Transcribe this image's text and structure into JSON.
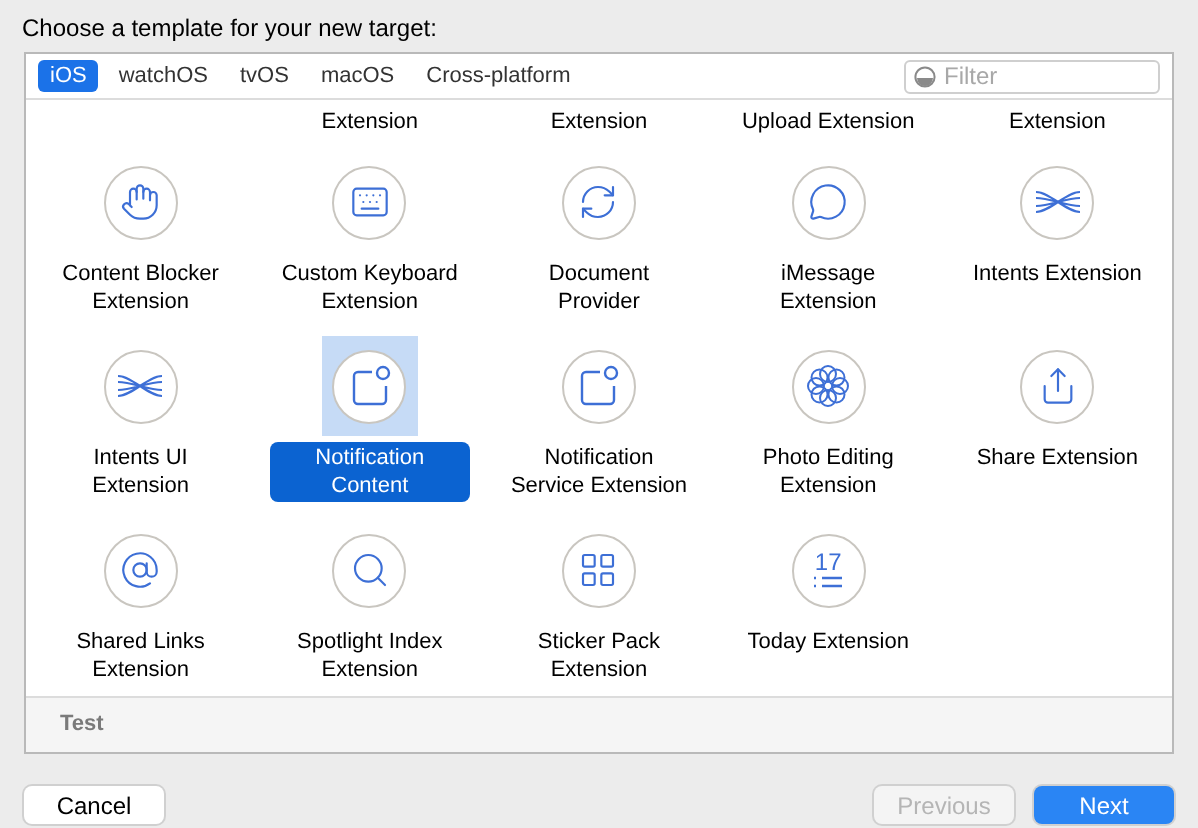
{
  "title": "Choose a template for your new target:",
  "tabs": [
    {
      "label": "iOS",
      "selected": true
    },
    {
      "label": "watchOS",
      "selected": false
    },
    {
      "label": "tvOS",
      "selected": false
    },
    {
      "label": "macOS",
      "selected": false
    },
    {
      "label": "Cross-platform",
      "selected": false
    }
  ],
  "filter": {
    "placeholder": "Filter"
  },
  "partial_row": [
    "Extension",
    "Extension",
    "Upload Extension",
    "Extension"
  ],
  "templates": [
    {
      "kind": "hand",
      "label": [
        "Content Blocker",
        "Extension"
      ],
      "selected": false
    },
    {
      "kind": "keyboard",
      "label": [
        "Custom Keyboard",
        "Extension"
      ],
      "selected": false
    },
    {
      "kind": "refresh",
      "label": [
        "Document",
        "Provider"
      ],
      "selected": false
    },
    {
      "kind": "bubble",
      "label": [
        "iMessage",
        "Extension"
      ],
      "selected": false
    },
    {
      "kind": "waves",
      "label": [
        "Intents Extension"
      ],
      "selected": false
    },
    {
      "kind": "waves",
      "label": [
        "Intents UI",
        "Extension"
      ],
      "selected": false
    },
    {
      "kind": "notification",
      "label": [
        "Notification",
        "Content"
      ],
      "selected": true
    },
    {
      "kind": "notification",
      "label": [
        "Notification",
        "Service Extension"
      ],
      "selected": false
    },
    {
      "kind": "flower",
      "label": [
        "Photo Editing",
        "Extension"
      ],
      "selected": false
    },
    {
      "kind": "share",
      "label": [
        "Share Extension"
      ],
      "selected": false
    },
    {
      "kind": "at",
      "label": [
        "Shared Links",
        "Extension"
      ],
      "selected": false
    },
    {
      "kind": "search",
      "label": [
        "Spotlight Index",
        "Extension"
      ],
      "selected": false
    },
    {
      "kind": "grid",
      "label": [
        "Sticker Pack",
        "Extension"
      ],
      "selected": false
    },
    {
      "kind": "calendar",
      "icon_text": "17",
      "label": [
        "Today Extension"
      ],
      "selected": false
    }
  ],
  "section": "Test",
  "buttons": [
    {
      "label": "Cancel",
      "kind": "default",
      "disabled": false
    },
    {
      "label": "Previous",
      "kind": "default",
      "disabled": true
    },
    {
      "label": "Next",
      "kind": "primary",
      "disabled": false
    }
  ]
}
